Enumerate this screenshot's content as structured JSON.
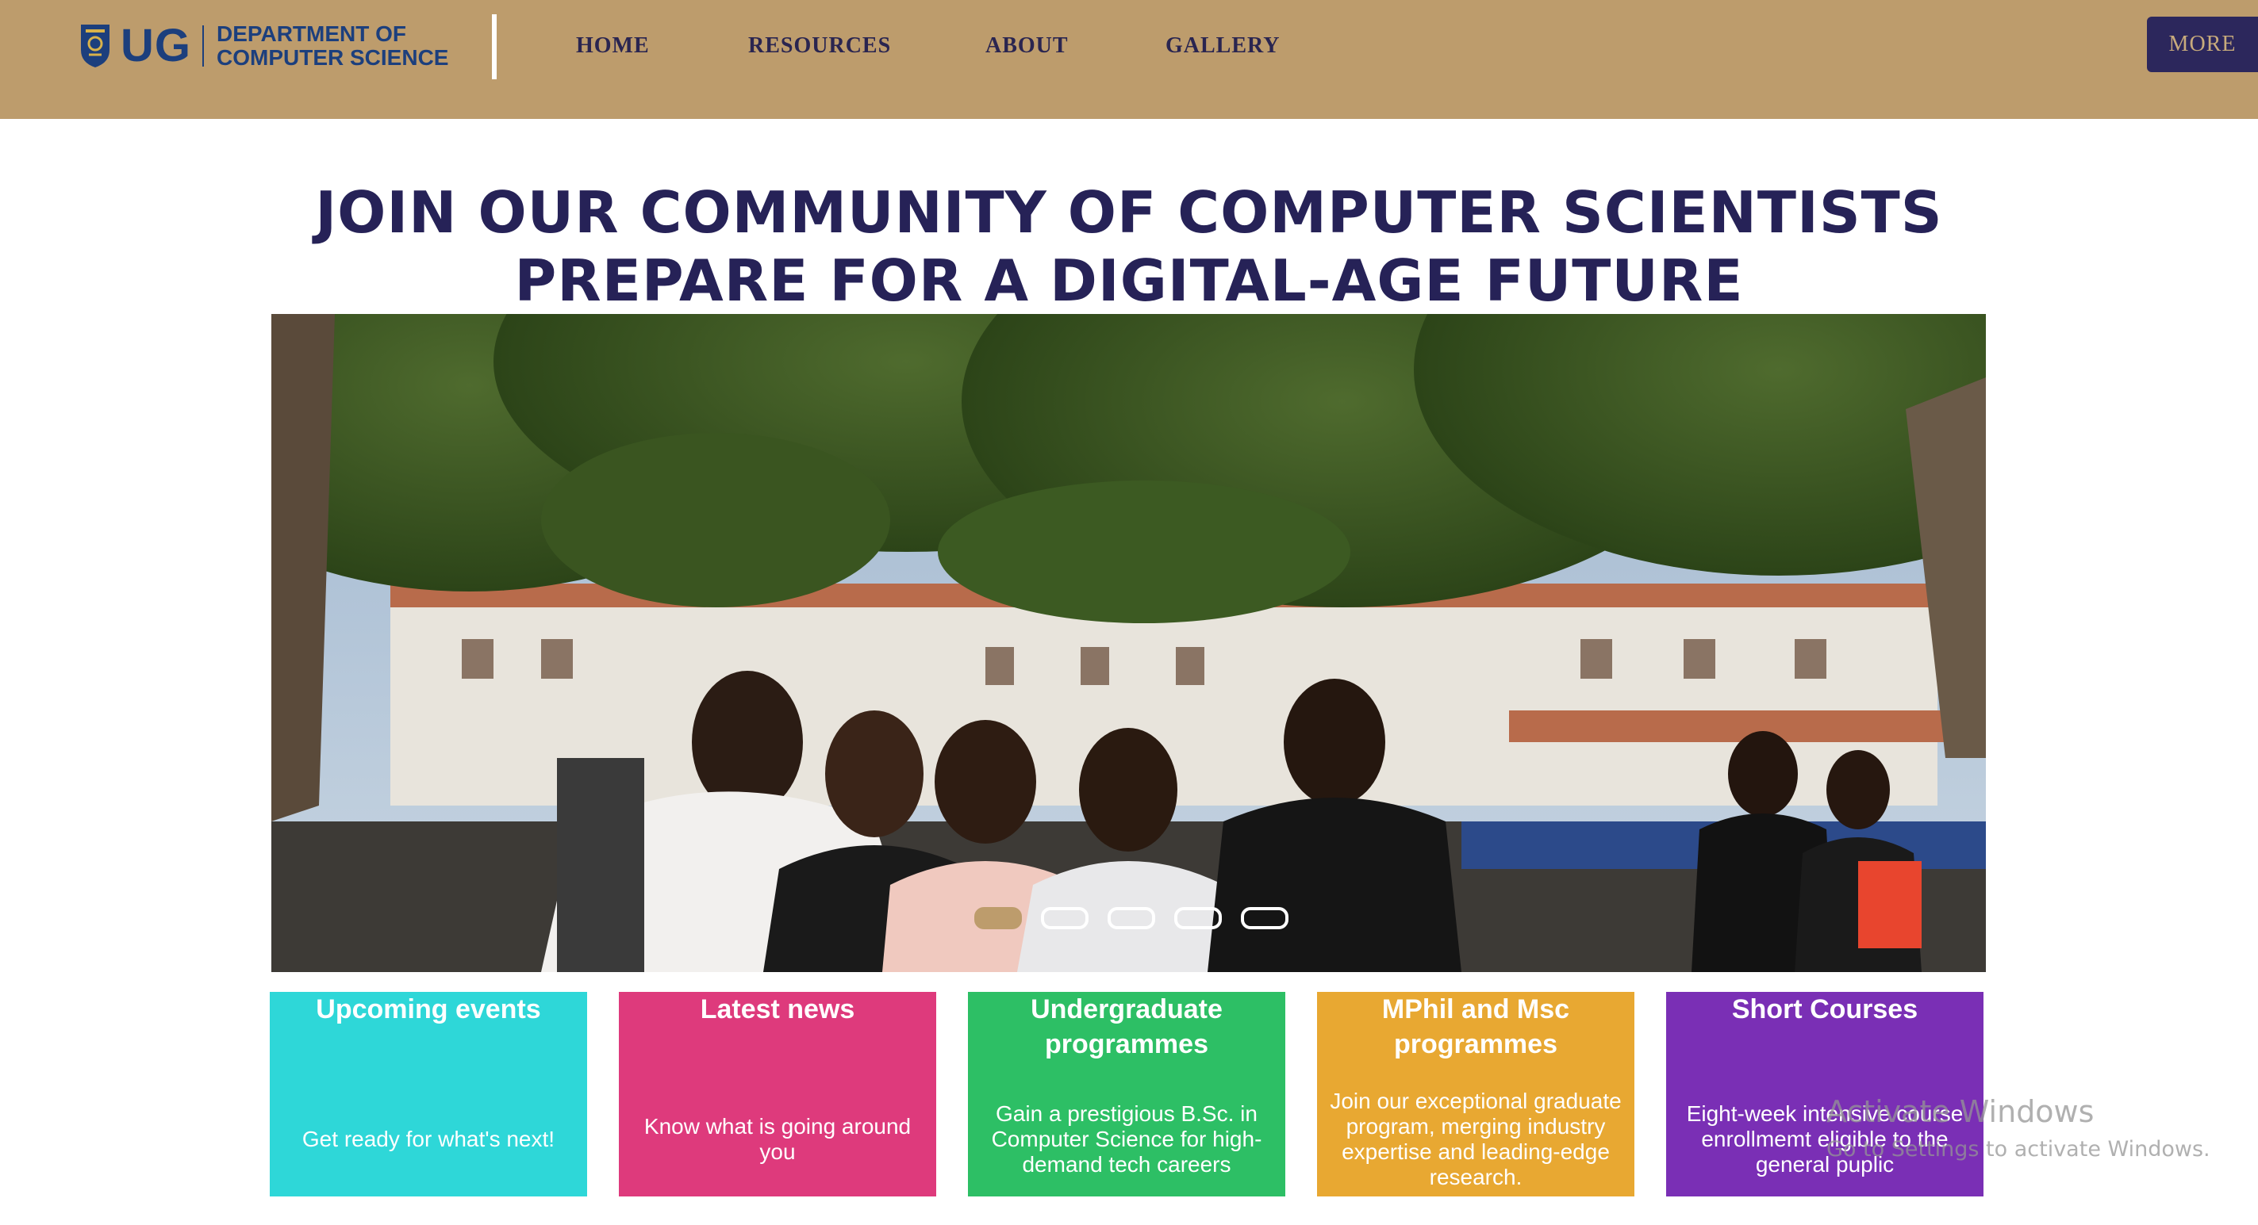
{
  "header": {
    "logo_ug": "UG",
    "logo_line1": "DEPARTMENT OF",
    "logo_line2": "COMPUTER SCIENCE",
    "nav": [
      "HOME",
      "RESOURCES",
      "ABOUT",
      "GALLERY"
    ],
    "more_label": "MORE"
  },
  "hero": {
    "headline_1": "JOIN OUR COMMUNITY OF COMPUTER SCIENTISTS",
    "headline_2": "PREPARE FOR A DIGITAL-AGE FUTURE",
    "carousel_slide_count": 5,
    "carousel_active_index": 0
  },
  "cards": [
    {
      "title": "Upcoming events",
      "desc": "Get ready for what's next!",
      "color": "#2ed7d8"
    },
    {
      "title": "Latest news",
      "desc": "Know what is going around you",
      "color": "#de3a7c"
    },
    {
      "title": "Undergraduate programmes",
      "desc": "Gain a prestigious B.Sc. in Computer Science for high-demand tech careers",
      "color": "#2dbf65"
    },
    {
      "title": "MPhil and Msc programmes",
      "desc": "Join our exceptional graduate program, merging industry expertise and leading-edge research.",
      "color": "#e8a832"
    },
    {
      "title": "Short Courses",
      "desc": "Eight-week intensive course enrollmemt eligible to the general puplic",
      "color": "#7a2fb5"
    }
  ],
  "watermark": {
    "line1": "Activate Windows",
    "line2": "Go to Settings to activate Windows."
  },
  "colors": {
    "header_bg": "#bd9c6c",
    "navy": "#262257",
    "more_bg": "#2c275c"
  }
}
